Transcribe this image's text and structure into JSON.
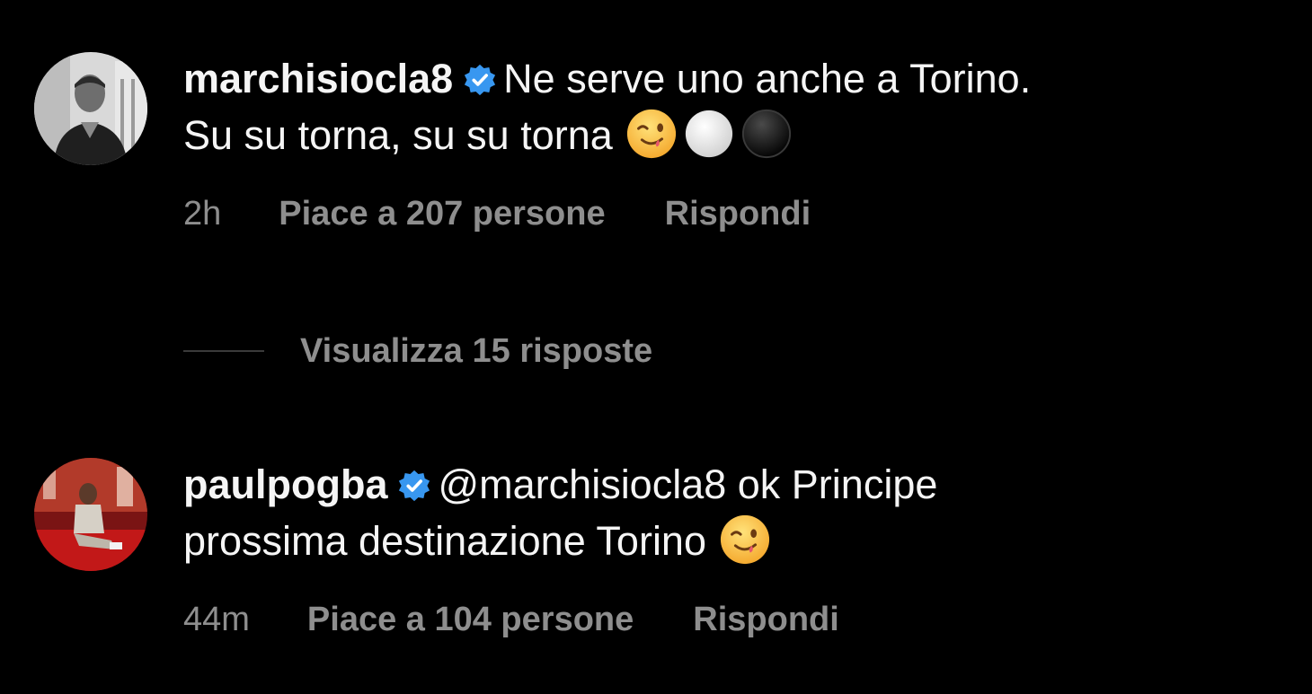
{
  "comments": [
    {
      "username": "marchisiocla8",
      "verified": true,
      "line1": "Ne serve uno anche a Torino.",
      "line2": "Su su torna, su su torna",
      "emojis": [
        "winking-face",
        "white-circle",
        "black-circle"
      ],
      "time": "2h",
      "likes": "Piace a 207 persone",
      "reply": "Rispondi"
    },
    {
      "username": "paulpogba",
      "verified": true,
      "line1": "@marchisiocla8 ok Principe",
      "line2": "prossima destinazione Torino",
      "emojis": [
        "winking-face"
      ],
      "time": "44m",
      "likes": "Piace a 104 persone",
      "reply": "Rispondi"
    }
  ],
  "view_replies": "Visualizza 15 risposte",
  "colors": {
    "background": "#000000",
    "text": "#f5f5f5",
    "muted": "#8e8e8e",
    "verified": "#3897f0",
    "divider": "#3a3a3a"
  }
}
